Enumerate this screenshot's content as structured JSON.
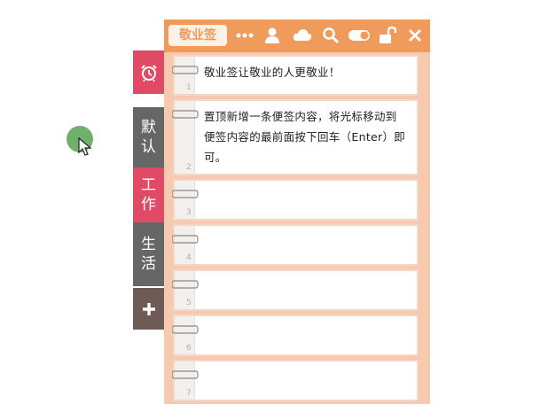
{
  "brand": "敬业签",
  "toolbar_icons": [
    "more-icon",
    "user-icon",
    "cloud-icon",
    "search-icon",
    "toggle-icon",
    "lock-icon",
    "close-icon"
  ],
  "tabs": [
    {
      "name": "tab-reminder",
      "label": "",
      "icon": "alarm-clock-icon",
      "color": "#e04a64"
    },
    {
      "name": "tab-default",
      "label": "默认",
      "color": "#666666"
    },
    {
      "name": "tab-work",
      "label": "工作",
      "color": "#e04a64"
    },
    {
      "name": "tab-life",
      "label": "生活",
      "color": "#666666"
    },
    {
      "name": "tab-add",
      "label": "",
      "icon": "plus-icon",
      "color": "#6e5b56"
    }
  ],
  "notes": [
    {
      "num": "1",
      "text": "敬业签让敬业的人更敬业！"
    },
    {
      "num": "2",
      "text": "置顶新增一条便签内容，将光标移动到便签内容的最前面按下回车（Enter）即可。"
    },
    {
      "num": "3",
      "text": ""
    },
    {
      "num": "4",
      "text": ""
    },
    {
      "num": "5",
      "text": ""
    },
    {
      "num": "6",
      "text": ""
    },
    {
      "num": "7",
      "text": ""
    }
  ],
  "colors": {
    "toolbar": "#f09a5c",
    "board": "#f7c9ae",
    "accent_red": "#e04a64",
    "gray": "#666666"
  }
}
